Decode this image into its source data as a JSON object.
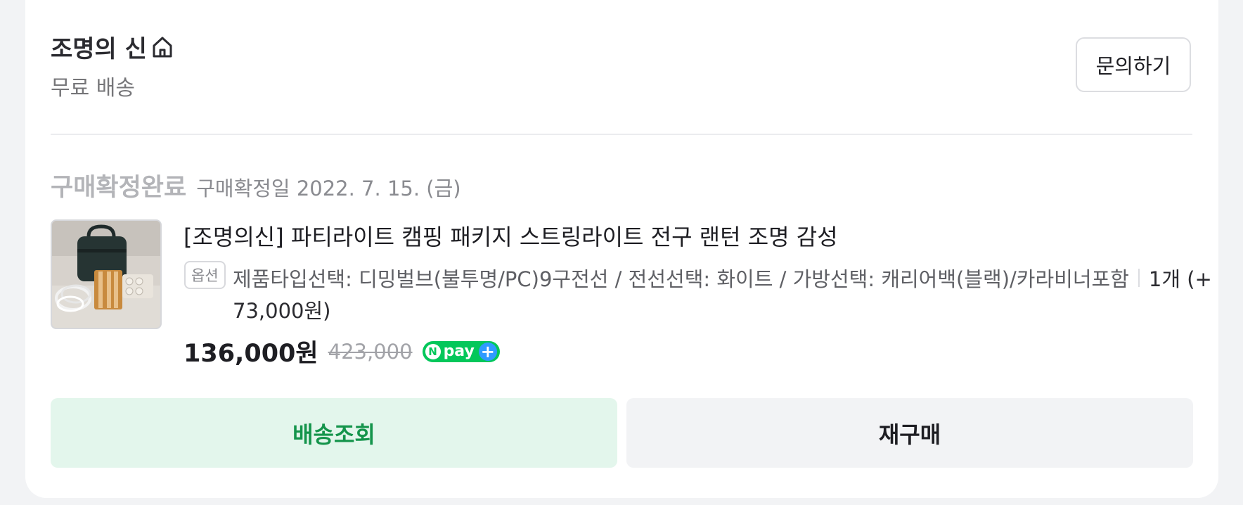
{
  "store": {
    "name": "조명의 신",
    "icon": "home-icon",
    "delivery": "무료 배송",
    "inquiry_label": "문의하기"
  },
  "order": {
    "status": "구매확정완료",
    "confirmed_date": "구매확정일 2022. 7. 15. (금)"
  },
  "product": {
    "title": "[조명의신] 파티라이트 캠핑 패키지 스트링라이트 전구 랜턴 조명 감성",
    "option_tag": "옵션",
    "option_text": "제품타입선택: 디밍벌브(불투명/PC)9구전선 / 전선선택: 화이트 / 가방선택: 캐리어백(블랙)/카라비너포함",
    "quantity": "1개 (+",
    "option_price": "73,000원)",
    "price": "136,000원",
    "original_price": "423,000",
    "payment_badge": {
      "n": "N",
      "text": "pay",
      "plus": "+"
    }
  },
  "actions": {
    "track_label": "배송조회",
    "rebuy_label": "재구매"
  },
  "colors": {
    "accent_green": "#03c75a",
    "track_text": "#14944b",
    "track_bg": "#e3f6ec",
    "npay_plus": "#2f9bff"
  }
}
